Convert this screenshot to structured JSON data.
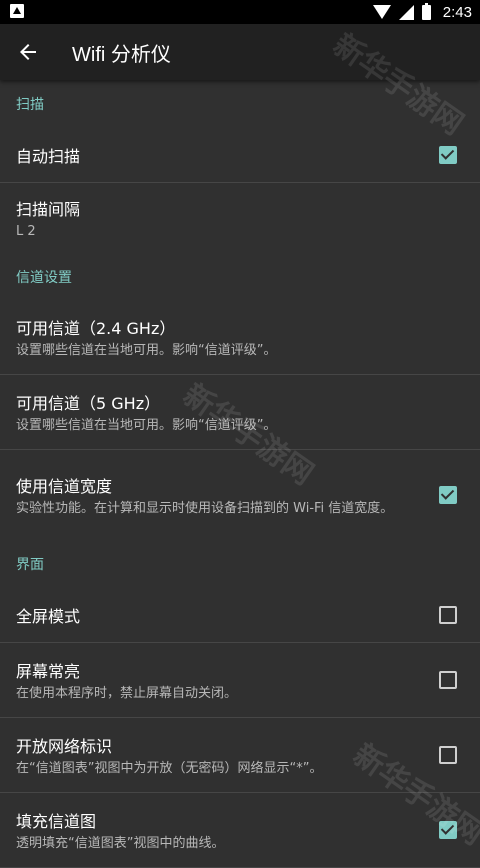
{
  "status_bar": {
    "time": "2:43"
  },
  "app_bar": {
    "title": "Wifi 分析仪",
    "back_icon": "arrow-back-icon"
  },
  "sections": {
    "scan": {
      "header": "扫描",
      "auto_scan": {
        "title": "自动扫描",
        "checked": true
      },
      "scan_interval": {
        "title": "扫描间隔",
        "value": "L 2"
      }
    },
    "channel": {
      "header": "信道设置",
      "ch24": {
        "title": "可用信道（2.4 GHz）",
        "summary": "设置哪些信道在当地可用。影响“信道评级”。"
      },
      "ch5": {
        "title": "可用信道（5 GHz）",
        "summary": "设置哪些信道在当地可用。影响“信道评级”。"
      },
      "width": {
        "title": "使用信道宽度",
        "summary": "实验性功能。在计算和显示时使用设备扫描到的 Wi-Fi 信道宽度。",
        "checked": true
      }
    },
    "ui": {
      "header": "界面",
      "fullscreen": {
        "title": "全屏模式",
        "checked": false
      },
      "screen_on": {
        "title": "屏幕常亮",
        "summary": "在使用本程序时，禁止屏幕自动关闭。",
        "checked": false
      },
      "open_mark": {
        "title": "开放网络标识",
        "summary": "在“信道图表”视图中为开放（无密码）网络显示“*”。",
        "checked": false
      },
      "fill_graph": {
        "title": "填充信道图",
        "summary": "透明填充“信道图表”视图中的曲线。",
        "checked": true
      }
    }
  },
  "watermark": "新华手游网",
  "colors": {
    "accent": "#80cbc4",
    "background": "#303030",
    "appbar": "#212121"
  }
}
